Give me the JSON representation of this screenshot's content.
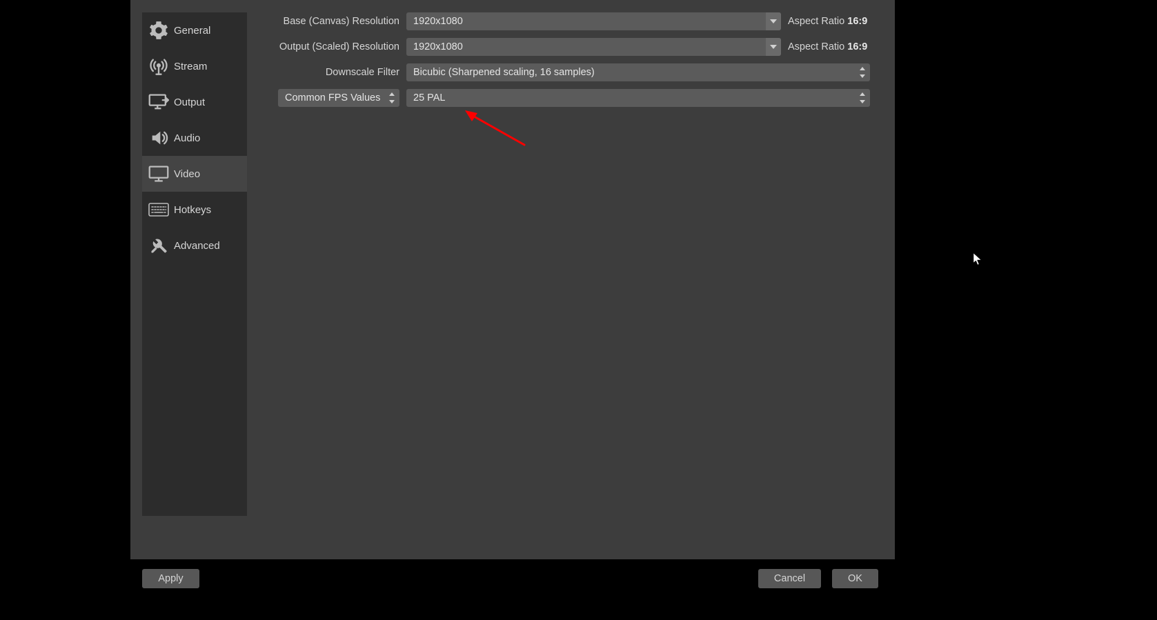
{
  "sidebar": {
    "items": [
      {
        "label": "General",
        "icon": "gear-icon"
      },
      {
        "label": "Stream",
        "icon": "antenna-icon"
      },
      {
        "label": "Output",
        "icon": "output-icon"
      },
      {
        "label": "Audio",
        "icon": "speaker-icon"
      },
      {
        "label": "Video",
        "icon": "monitor-icon"
      },
      {
        "label": "Hotkeys",
        "icon": "keyboard-icon"
      },
      {
        "label": "Advanced",
        "icon": "tools-icon"
      }
    ],
    "selected_index": 4
  },
  "labels": {
    "base_resolution": "Base (Canvas) Resolution",
    "output_resolution": "Output (Scaled) Resolution",
    "downscale_filter": "Downscale Filter",
    "fps_mode": "Common FPS Values",
    "aspect_ratio": "Aspect Ratio"
  },
  "values": {
    "base_resolution": "1920x1080",
    "output_resolution": "1920x1080",
    "downscale_filter": "Bicubic (Sharpened scaling, 16 samples)",
    "fps_value": "25 PAL",
    "base_aspect_ratio": "16:9",
    "output_aspect_ratio": "16:9"
  },
  "buttons": {
    "apply": "Apply",
    "cancel": "Cancel",
    "ok": "OK"
  },
  "annotation": {
    "arrow_color": "#ff0000"
  }
}
